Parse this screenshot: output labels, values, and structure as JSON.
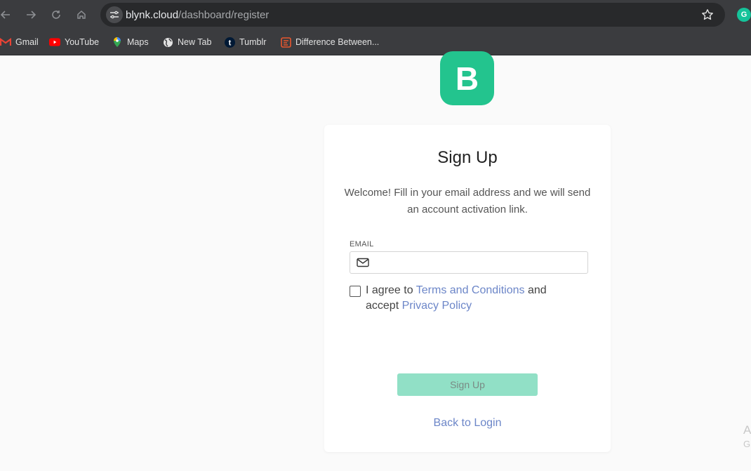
{
  "browser": {
    "url_host": "blynk.cloud",
    "url_path": "/dashboard/register",
    "extension_letter": "G",
    "icons": {
      "back": "arrow-left-icon",
      "forward": "arrow-right-icon",
      "reload": "reload-icon",
      "home": "home-icon",
      "site_settings": "tune-icon",
      "bookmark": "star-icon"
    }
  },
  "bookmarks": [
    {
      "label": "Gmail",
      "icon": "gmail-icon"
    },
    {
      "label": "YouTube",
      "icon": "youtube-icon"
    },
    {
      "label": "Maps",
      "icon": "maps-icon"
    },
    {
      "label": "New Tab",
      "icon": "globe-icon"
    },
    {
      "label": "Tumblr",
      "icon": "tumblr-icon"
    },
    {
      "label": "Difference Between...",
      "icon": "bookmark-site-icon"
    }
  ],
  "logo": {
    "letter": "B",
    "color": "#23c48e"
  },
  "form": {
    "title": "Sign Up",
    "subtitle": "Welcome! Fill in your email address and we will send an account activation link.",
    "email_label": "EMAIL",
    "email_value": "",
    "agree_prefix": "I agree to",
    "terms_link": "Terms and Conditions",
    "agree_mid": "and accept",
    "privacy_link": "Privacy Policy",
    "submit_label": "Sign Up",
    "back_link": "Back to Login",
    "accent": "#6c86c8",
    "button_color": "#91e0c6"
  },
  "edge_text": {
    "line1": "A",
    "line2": "G"
  }
}
